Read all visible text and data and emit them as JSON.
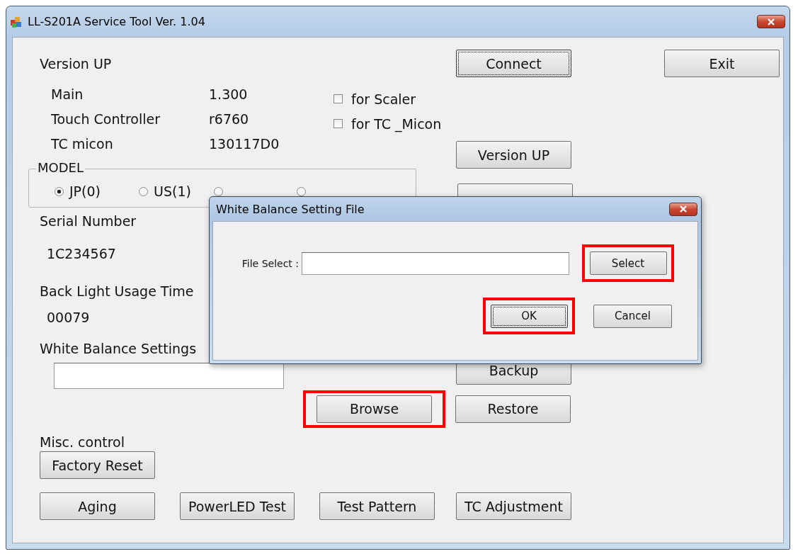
{
  "window": {
    "title": "LL-S201A Service Tool  Ver. 1.04"
  },
  "top_buttons": [
    {
      "label": "Connect",
      "focused": true
    },
    {
      "label": "Exit",
      "focused": false
    }
  ],
  "version_up": {
    "label": "Version UP",
    "items": [
      {
        "label": "Main",
        "value": "1.300"
      },
      {
        "label": "Touch Controller",
        "value": "r6760"
      },
      {
        "label": "TC micon",
        "value": "130117D0"
      }
    ],
    "options": [
      {
        "label": "for Scaler",
        "checked": false
      },
      {
        "label": "for TC _Micon",
        "checked": false
      }
    ],
    "button": {
      "label": "Version UP",
      "focused": false
    }
  },
  "model": {
    "label": "MODEL",
    "options": [
      {
        "label": "JP(0)",
        "selected": true
      },
      {
        "label": "US(1)",
        "selected": false
      },
      {
        "selected": false
      },
      {
        "selected": false
      }
    ]
  },
  "serial_number": {
    "label": "Serial Number",
    "value": "1C234567"
  },
  "back_light": {
    "label": "Back Light Usage Time",
    "value": "00079"
  },
  "white_balance": {
    "label": "White Balance Settings",
    "buttons": [
      {
        "label": "Backup",
        "focused": false,
        "highlighted": false
      },
      {
        "label": "Browse",
        "focused": false,
        "highlighted": true
      },
      {
        "label": "Restore",
        "focused": false,
        "highlighted": false
      }
    ]
  },
  "misc": {
    "label": "Misc. control",
    "buttons": [
      {
        "label": "Factory Reset",
        "focused": false
      },
      {
        "label": "Aging",
        "focused": false
      },
      {
        "label": "PowerLED Test",
        "focused": false
      },
      {
        "label": "Test Pattern",
        "focused": false
      },
      {
        "label": "TC Adjustment",
        "focused": false
      }
    ]
  },
  "dialog": {
    "title": "White Balance Setting File",
    "field_label": "File Select :",
    "buttons": [
      {
        "label": "Select",
        "focused": false,
        "highlighted": true
      },
      {
        "label": "OK",
        "focused": true,
        "highlighted": true
      },
      {
        "label": "Cancel",
        "focused": false,
        "highlighted": false
      }
    ]
  }
}
